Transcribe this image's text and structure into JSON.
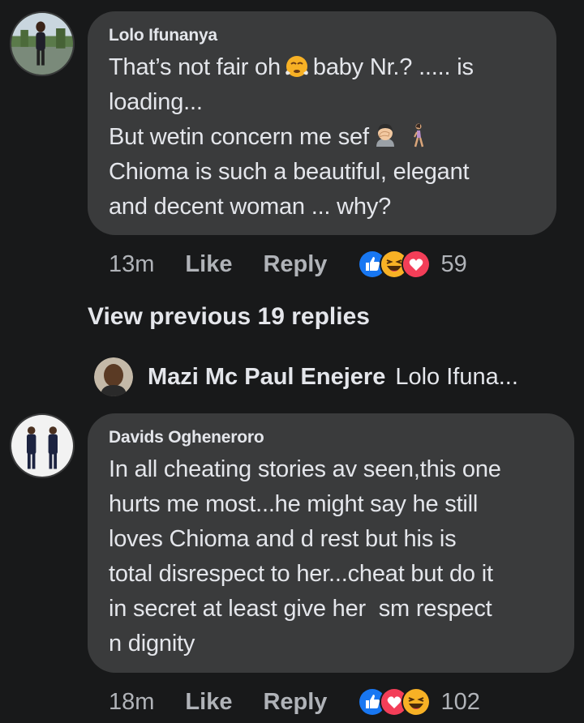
{
  "comments": [
    {
      "author": "Lolo Ifunanya",
      "lines": [
        [
          "That’s not fair oh ",
          "{emoji:steam}",
          " baby Nr.? ..... is"
        ],
        [
          "loading..."
        ],
        [
          "But wetin concern me sef ",
          "{emoji:facepalm}",
          " ",
          "{emoji:walking}"
        ],
        [
          "Chioma is such a beautiful, elegant"
        ],
        [
          "and decent woman ... why?"
        ]
      ],
      "line_text": [
        "That’s not fair oh",
        "baby Nr.? ..... is",
        "loading...",
        "But wetin concern me sef",
        "Chioma is such a beautiful, elegant",
        "and decent woman ... why?"
      ],
      "time": "13m",
      "like_label": "Like",
      "reply_label": "Reply",
      "reactions": [
        "like-reaction-icon",
        "haha-reaction-icon",
        "love-reaction-icon"
      ],
      "reaction_count": "59"
    },
    {
      "author": "Davids Ogheneroro",
      "line_text": [
        "In all cheating stories av seen,this one",
        "hurts me most...he might say he still",
        "loves Chioma and d rest but his is",
        "total disrespect to her...cheat but do it",
        "in secret at least give her  sm respect",
        "n dignity"
      ],
      "time": "18m",
      "like_label": "Like",
      "reply_label": "Reply",
      "reactions": [
        "like-reaction-icon",
        "love-reaction-icon",
        "haha-reaction-icon"
      ],
      "reaction_count": "102"
    }
  ],
  "view_previous": "View previous 19 replies",
  "reply_preview": {
    "author": "Mazi Mc Paul Enejere",
    "snippet": "Lolo Ifuna..."
  },
  "colors": {
    "background": "#18191a",
    "bubble": "#3a3b3c",
    "text": "#e4e6eb",
    "secondary": "#b0b3b8",
    "like_blue": "#1877f2",
    "love_red": "#f33e58",
    "haha_yellow": "#f7b125"
  }
}
